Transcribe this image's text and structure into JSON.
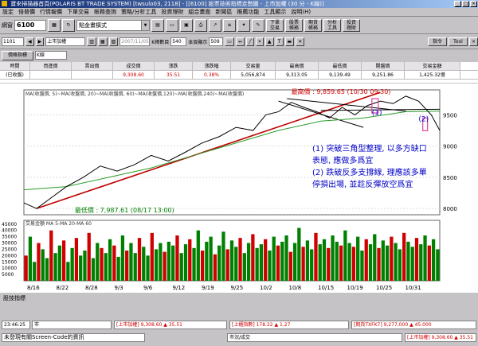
{
  "window": {
    "title": "寶來掃描器首頁(POLARIS BT TRADE SYSTEM) [twsulo03, 2118] - [[6100] 股票技術指標走勢圖 - 上市加權 (30 分 - K線)]"
  },
  "menu": [
    "設定",
    "倍普價",
    "行情報價",
    "下單交易",
    "帳務查詢",
    "策略/分析工具",
    "投資理財",
    "組合畫面",
    "新聞區",
    "推薦功能",
    "工具顯示",
    "說明(H)"
  ],
  "toolbar": {
    "code_label": "網窗",
    "code_value": "6100",
    "view_select": "點金畫橫式",
    "buttons": [
      "下單交易",
      "股票帳務",
      "期貨帳務",
      "分析工具",
      "投資理財"
    ]
  },
  "toolbar2": {
    "symbol": "1101",
    "symbol_name": "上市加權",
    "date": "2007/11/05",
    "count_label": "K棒數目",
    "count_value": "540",
    "page_label": "本頁顯示",
    "page_value": "509",
    "right_buttons": [
      "指令",
      "Tool"
    ]
  },
  "toolbar3": {
    "indicator_button": "價格指標",
    "period": "K線"
  },
  "quote": {
    "headers": [
      "時間",
      "買進價",
      "賣出價",
      "成交價",
      "漲跌",
      "漲跌幅",
      "交易量",
      "最高價",
      "最低價",
      "開盤價",
      "交易金額"
    ],
    "values": [
      "13:30",
      "",
      "",
      "9,308.60",
      "35.51",
      "0.38%",
      "5,056,874",
      "9,313.05",
      "9,139.49",
      "9,251.86",
      "1,425.32億"
    ],
    "row_label": "(已收盤)"
  },
  "chart_data": {
    "type": "line",
    "ma_legend": "MA(收盤價, 5)~MA(收盤價, 20)~MA(收盤價, 60)~MA(收盤價,120)~MA(收盤價,240)~MA(收盤價)",
    "high_label": "最高價 : 9,859.65 (10/30 09:30)",
    "low_label": "最低價 : 7,987.61 (08/17 13:00)",
    "y_ticks": [
      "9500",
      "9000",
      "8500",
      "8000"
    ],
    "ylim": [
      7900,
      9900
    ],
    "x_ticks": [
      "8/16",
      "8/22",
      "8/28",
      "9/3",
      "9/6",
      "9/12",
      "9/19",
      "9/25",
      "10/2",
      "10/8",
      "10/15",
      "10/19",
      "10/25",
      "10/31"
    ],
    "close_points": [
      [
        0,
        8090
      ],
      [
        3,
        8000
      ],
      [
        6,
        8150
      ],
      [
        10,
        8350
      ],
      [
        14,
        8500
      ],
      [
        18,
        8680
      ],
      [
        22,
        8600
      ],
      [
        26,
        8700
      ],
      [
        30,
        8850
      ],
      [
        34,
        8760
      ],
      [
        38,
        8900
      ],
      [
        42,
        9050
      ],
      [
        46,
        9150
      ],
      [
        50,
        9300
      ],
      [
        54,
        9250
      ],
      [
        57,
        9500
      ],
      [
        60,
        9550
      ],
      [
        63,
        9700
      ],
      [
        66,
        9620
      ],
      [
        69,
        9550
      ],
      [
        72,
        9450
      ],
      [
        75,
        9620
      ],
      [
        78,
        9500
      ],
      [
        81,
        9650
      ],
      [
        84,
        9720
      ],
      [
        87,
        9680
      ],
      [
        90,
        9800
      ],
      [
        93,
        9720
      ],
      [
        96,
        9500
      ],
      [
        98,
        9250
      ]
    ],
    "ma_points": [
      [
        0,
        8300
      ],
      [
        10,
        8350
      ],
      [
        20,
        8500
      ],
      [
        30,
        8650
      ],
      [
        40,
        8850
      ],
      [
        50,
        9050
      ],
      [
        60,
        9250
      ],
      [
        70,
        9400
      ],
      [
        80,
        9450
      ],
      [
        90,
        9550
      ],
      [
        98,
        9560
      ]
    ],
    "annotation_lines": [
      "(1) 突破三角型整理, 以多方缺口",
      "表態, 應做多爲宜",
      "(2) 跌破反多支撐線, 理應該多單",
      "停損出場, 並趁反彈放空爲宜"
    ],
    "mark_1": "(1)",
    "mark_2": "(2)",
    "volume_legend": "交易金額 MA 5-MA 20-MA 60",
    "volume_ticks": [
      "45000",
      "40000",
      "35000",
      "30000",
      "25000",
      "20000",
      "15000",
      "10000",
      "5000"
    ],
    "volume_values": [
      20,
      35,
      15,
      30,
      25,
      18,
      40,
      22,
      28,
      32,
      15,
      26,
      34,
      20,
      24,
      38,
      18,
      30,
      26,
      22,
      33,
      28,
      19,
      36,
      24,
      30,
      22,
      34,
      27,
      20,
      38,
      25,
      30,
      23,
      31,
      28,
      36,
      22,
      29,
      33,
      26,
      40,
      24,
      31,
      35,
      21,
      28,
      39,
      25,
      32,
      27,
      34,
      22,
      30,
      37,
      26,
      29,
      33,
      24,
      35,
      28,
      31,
      36,
      23,
      30,
      42,
      27,
      32,
      25,
      38,
      29,
      33,
      26,
      36,
      31,
      28,
      40,
      30,
      27,
      35,
      24,
      33,
      29,
      37,
      26,
      32,
      28,
      35,
      30,
      25,
      38,
      31,
      27,
      34,
      29,
      36,
      28,
      33,
      25
    ]
  },
  "bottom": {
    "section_label": "股技指標",
    "time": "23:46:25",
    "market": "市",
    "q1_label": "[上市加權]",
    "q1_price": "9,308.60",
    "q1_chg": "▲ 35.51",
    "q2_label": "[上櫃指數]",
    "q2_price": "178.22",
    "q2_chg": "▲ 1.27",
    "q3_label": "[期貨TXFK7]",
    "q3_price": "9,277,000",
    "q3_chg": "▲ 45.000",
    "status_msg": "未發現有關Screen-Code的資訊",
    "q4_label": "市況/成交",
    "q5_label": "[上市加權]",
    "q5_price": "9,308.60",
    "q5_chg": "▲ 35.51"
  }
}
